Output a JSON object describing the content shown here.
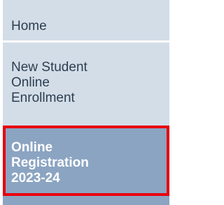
{
  "nav": {
    "items": [
      {
        "lines": [
          "Home"
        ]
      },
      {
        "lines": [
          "New Student",
          "Online",
          "Enrollment"
        ]
      },
      {
        "lines": [
          "Online",
          "Registration",
          "2023-24"
        ],
        "selected": true
      }
    ]
  },
  "colors": {
    "item_bg": "#d3dde8",
    "item_text": "#2d3e50",
    "selected_bg": "#8ba4c2",
    "selected_text": "#ffffff",
    "highlight_border": "#e8000d"
  }
}
